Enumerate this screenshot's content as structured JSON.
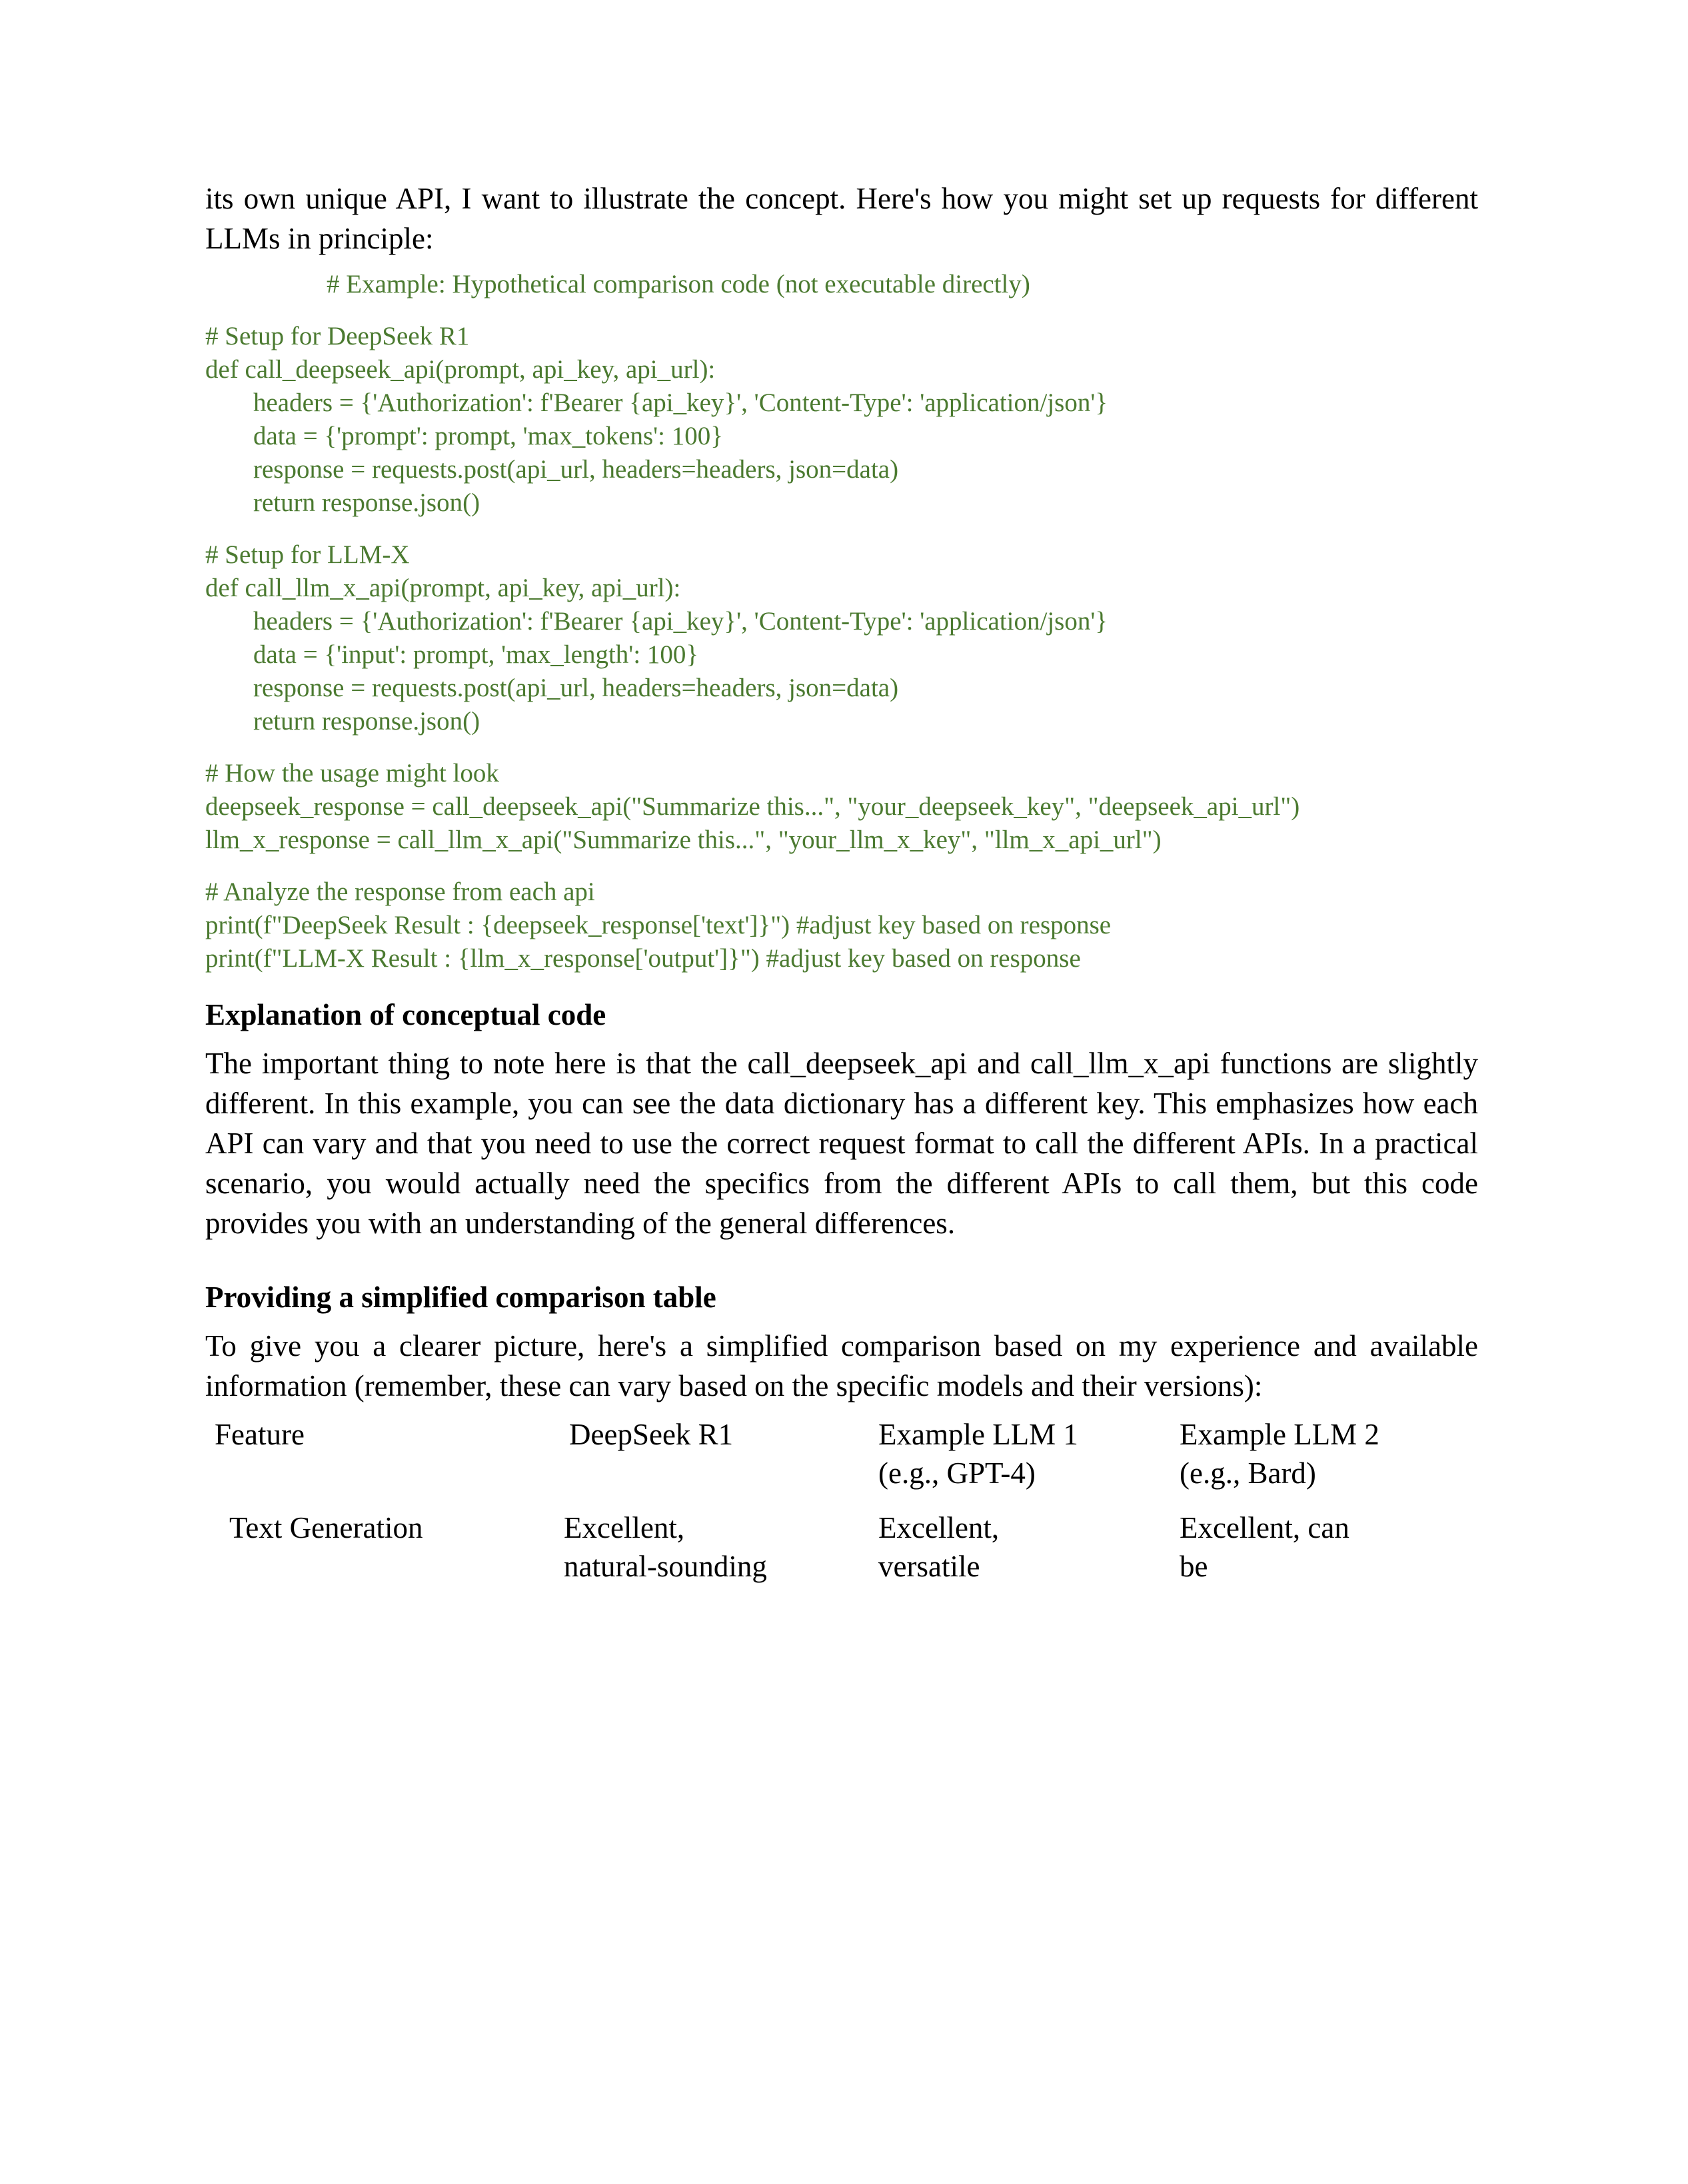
{
  "document": {
    "intro_paragraph": "its own unique API, I want to illustrate the concept. Here's how you might set up requests for different LLMs in principle:",
    "code": {
      "title_comment": "# Example: Hypothetical comparison code (not executable directly)",
      "block_deepseek": [
        "# Setup for DeepSeek R1",
        "def call_deepseek_api(prompt, api_key, api_url):",
        "headers = {'Authorization': f'Bearer {api_key}', 'Content-Type': 'application/json'}",
        "data = {'prompt': prompt, 'max_tokens': 100}",
        "response = requests.post(api_url, headers=headers, json=data)",
        "return response.json()"
      ],
      "block_llmx": [
        "# Setup for LLM-X",
        "def call_llm_x_api(prompt, api_key, api_url):",
        "headers = {'Authorization': f'Bearer {api_key}', 'Content-Type': 'application/json'}",
        "data = {'input': prompt, 'max_length': 100}",
        "response = requests.post(api_url, headers=headers, json=data)",
        "return response.json()"
      ],
      "block_usage": {
        "comment": "# How the usage might look",
        "line_deepseek": "deepseek_response = call_deepseek_api(\"Summarize this...\", \"your_deepseek_key\", \"deepseek_api_url\")",
        "line_llmx": "llm_x_response = call_llm_x_api(\"Summarize this...\", \"your_llm_x_key\", \"llm_x_api_url\")"
      },
      "block_analyze": [
        "# Analyze the response from each api",
        "print(f\"DeepSeek Result : {deepseek_response['text']}\") #adjust key based on response",
        "print(f\"LLM-X Result : {llm_x_response['output']}\") #adjust key based on response"
      ]
    },
    "section_explanation": {
      "heading": "Explanation of conceptual code",
      "paragraph": "The important thing to note here is that the call_deepseek_api and call_llm_x_api functions are slightly different. In this example, you can see the data dictionary has a different key. This emphasizes how each API can vary and that you need to use the correct request format to call the different APIs. In a practical scenario, you would actually need the specifics from the different APIs to call them, but this code provides you with an understanding of the general differences."
    },
    "section_table": {
      "heading": "Providing a simplified comparison table",
      "paragraph": "To give you a clearer picture, here's a simplified comparison based on my experience and available information (remember, these can vary based on the specific models and their versions):"
    },
    "comparison_table": {
      "headers": [
        {
          "line1": "Feature",
          "line2": ""
        },
        {
          "line1": "DeepSeek R1",
          "line2": ""
        },
        {
          "line1": "Example LLM 1",
          "line2": "(e.g., GPT-4)"
        },
        {
          "line1": "Example LLM 2",
          "line2": "(e.g., Bard)"
        }
      ],
      "rows": [
        {
          "feature": "Text Generation",
          "deepseek": {
            "line1": "Excellent,",
            "line2": "natural-sounding"
          },
          "llm1": {
            "line1": "Excellent,",
            "line2": "versatile"
          },
          "llm2": {
            "line1": "Excellent, can",
            "line2": "be"
          }
        }
      ]
    },
    "colors": {
      "code_green": "#4b7a30",
      "body_text": "#000000",
      "page_background": "#ffffff"
    }
  }
}
